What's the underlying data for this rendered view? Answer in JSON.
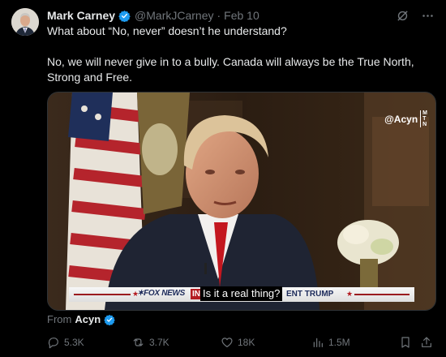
{
  "post": {
    "author_name": "Mark Carney",
    "handle": "@MarkJCarney",
    "separator": "·",
    "date": "Feb 10",
    "paragraph_1": "What about “No, never” doesn’t he understand?",
    "paragraph_2": "No, we will never give in to a bully. Canada will always be the True North, Strong and Free."
  },
  "media": {
    "watermark": "@Acyn",
    "watermark_logo": [
      "M",
      "T",
      "N"
    ],
    "network": "FOX NEWS",
    "network_prefix": "✶",
    "in_tag": "IN",
    "caption": "Is it a real thing?",
    "chyron_suffix": "ENT TRUMP",
    "chyron_star_left": "★",
    "chyron_star_right": "★"
  },
  "attribution": {
    "prefix": "From",
    "source": "Acyn"
  },
  "actions": {
    "replies": "5.3K",
    "reposts": "3.7K",
    "likes": "18K",
    "views": "1.5M"
  },
  "colors": {
    "background": "#000000",
    "text": "#e7e9ea",
    "muted": "#71767b",
    "verified": "#1d9bf0"
  },
  "icons": [
    "verified-badge-icon",
    "grok-icon",
    "more-icon",
    "reply-icon",
    "repost-icon",
    "like-icon",
    "views-icon",
    "bookmark-icon",
    "share-icon"
  ]
}
